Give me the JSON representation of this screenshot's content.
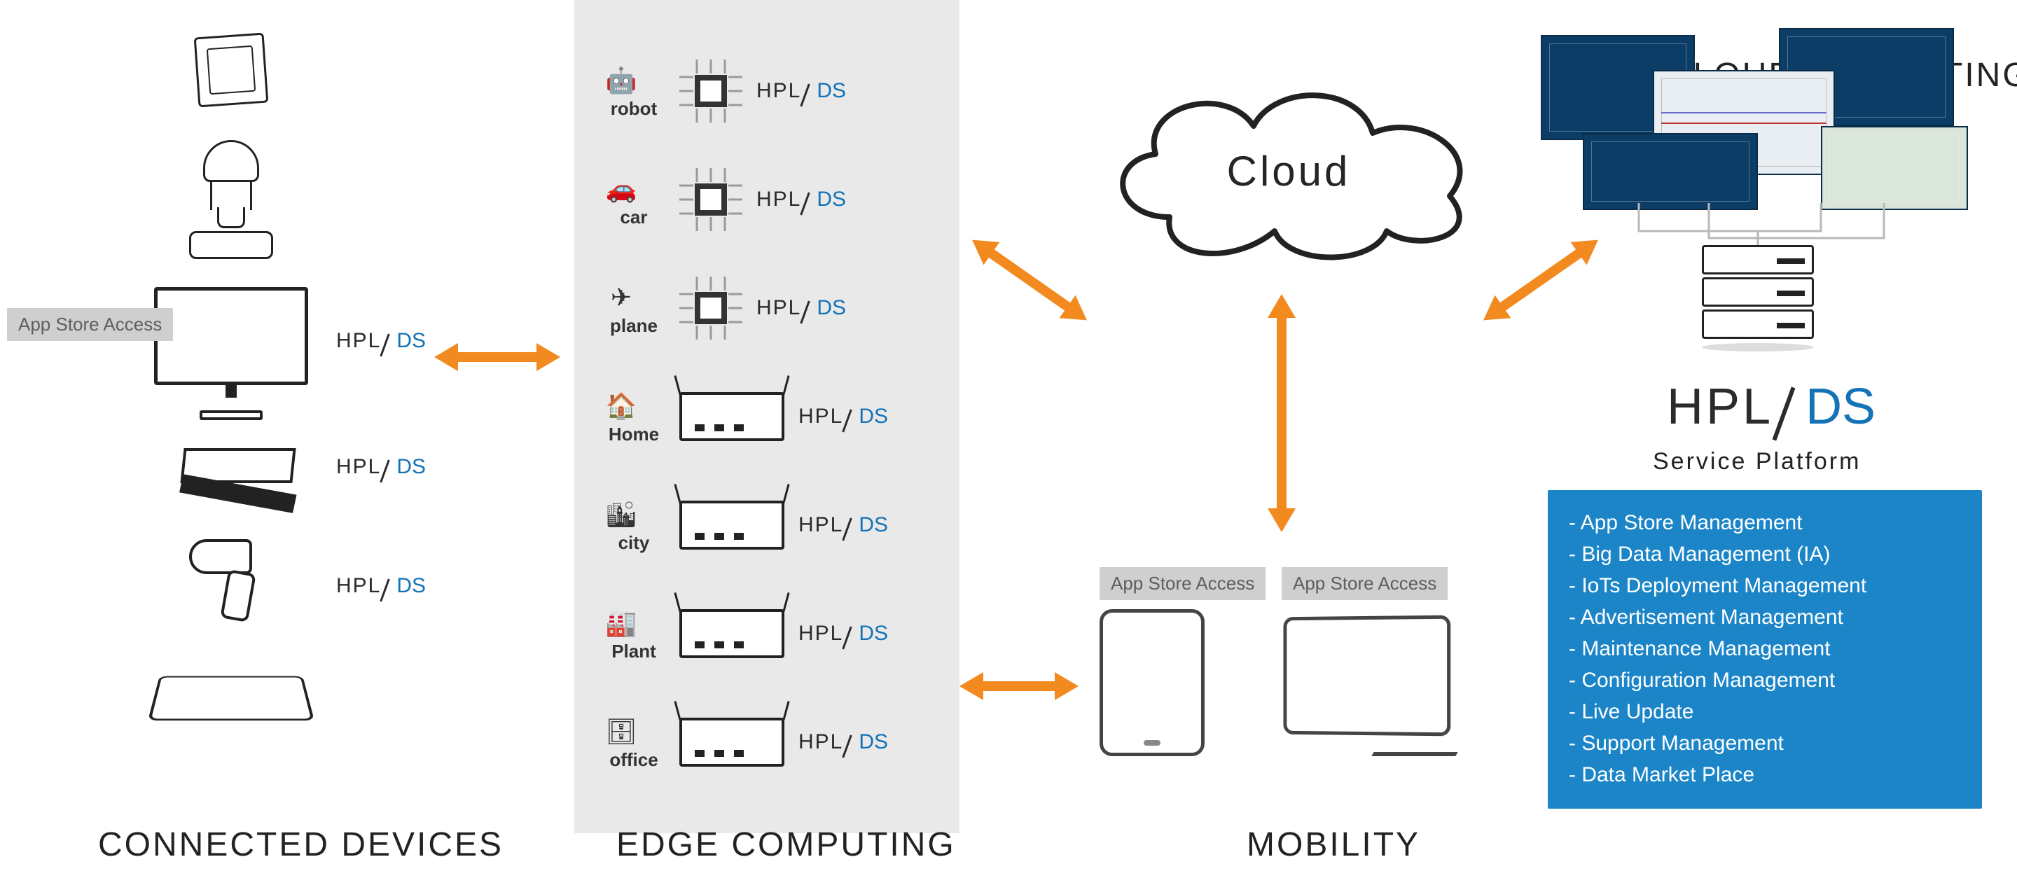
{
  "sections": {
    "devices": "Connected Devices",
    "edge": "Edge Computing",
    "mobility": "Mobility",
    "cloud": "Cloud Computing"
  },
  "hpl": {
    "left": "HPL",
    "right": "DS"
  },
  "app_store_access": "App Store Access",
  "cloud_label": "Cloud",
  "service_platform_label": "Service Platform",
  "edge_rows": [
    {
      "id": "robot",
      "label": "robot",
      "hw": "chip",
      "icon": "🤖"
    },
    {
      "id": "car",
      "label": "car",
      "hw": "chip",
      "icon": "🚗"
    },
    {
      "id": "plane",
      "label": "plane",
      "hw": "chip",
      "icon": "✈"
    },
    {
      "id": "home",
      "label": "Home",
      "hw": "router",
      "icon": "🏠"
    },
    {
      "id": "city",
      "label": "city",
      "hw": "router",
      "icon": "🏙"
    },
    {
      "id": "plant",
      "label": "Plant",
      "hw": "router",
      "icon": "🏭"
    },
    {
      "id": "office",
      "label": "office",
      "hw": "router",
      "icon": "🗄"
    }
  ],
  "devices": [
    {
      "name": "thermostat"
    },
    {
      "name": "coffee-machine"
    },
    {
      "name": "monitor",
      "hpl": true,
      "appstore": true
    },
    {
      "name": "set-top-box",
      "hpl": true
    },
    {
      "name": "drill",
      "hpl": true
    },
    {
      "name": "scale"
    }
  ],
  "features": [
    "App Store Management",
    "Big Data Management (IA)",
    "IoTs Deployment Management",
    "Advertisement Management",
    "Maintenance Management",
    "Configuration Management",
    "Live Update",
    "Support Management",
    "Data Market Place"
  ]
}
